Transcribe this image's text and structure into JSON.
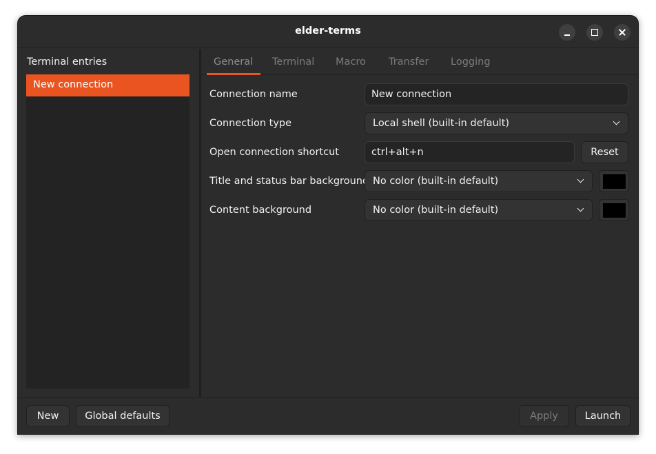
{
  "window": {
    "title": "elder-terms"
  },
  "sidebar": {
    "heading": "Terminal entries",
    "entries": [
      {
        "label": "New connection",
        "selected": true
      }
    ]
  },
  "tabs": [
    {
      "label": "General",
      "active": true
    },
    {
      "label": "Terminal",
      "active": false
    },
    {
      "label": "Macro",
      "active": false
    },
    {
      "label": "Transfer",
      "active": false
    },
    {
      "label": "Logging",
      "active": false
    }
  ],
  "form": {
    "connection_name": {
      "label": "Connection name",
      "value": "New connection"
    },
    "connection_type": {
      "label": "Connection type",
      "value": "Local shell (built-in default)"
    },
    "shortcut": {
      "label": "Open connection shortcut",
      "value": "ctrl+alt+n",
      "reset_label": "Reset"
    },
    "title_bg": {
      "label": "Title and status bar background",
      "value": "No color (built-in default)",
      "swatch_color": "#000000"
    },
    "content_bg": {
      "label": "Content background",
      "value": "No color (built-in default)",
      "swatch_color": "#000000"
    }
  },
  "footer": {
    "new_label": "New",
    "global_defaults_label": "Global defaults",
    "apply_label": "Apply",
    "launch_label": "Launch"
  },
  "colors": {
    "accent": "#e95420",
    "window_bg": "#2c2c2c",
    "list_bg": "#232323"
  }
}
